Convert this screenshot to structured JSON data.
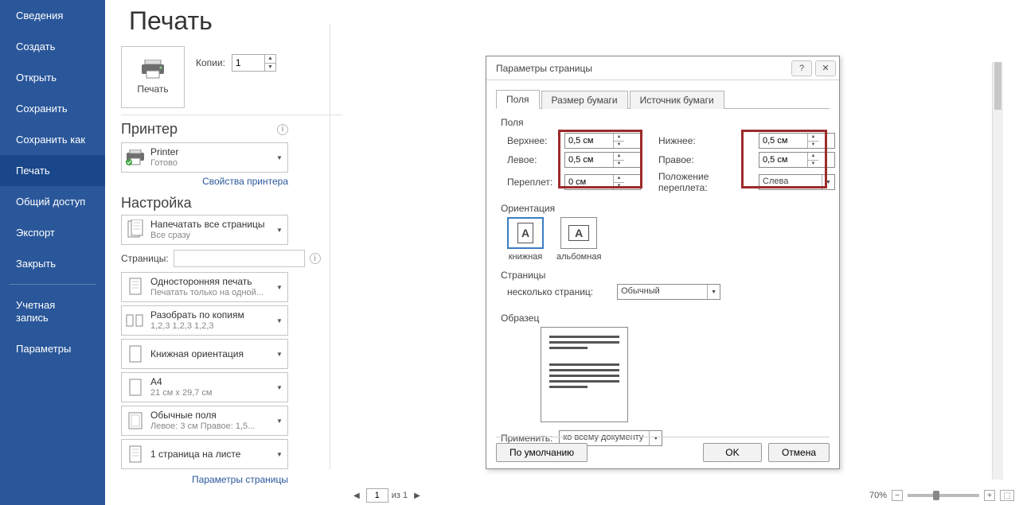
{
  "sidebar": {
    "items": [
      "Сведения",
      "Создать",
      "Открыть",
      "Сохранить",
      "Сохранить как",
      "Печать",
      "Общий доступ",
      "Экспорт",
      "Закрыть"
    ],
    "active_index": 5,
    "account_items": [
      "Учетная запись",
      "Параметры"
    ]
  },
  "page_title": "Печать",
  "print_button": "Печать",
  "copies_label": "Копии:",
  "copies_value": "1",
  "printer_section": "Принтер",
  "printer": {
    "name": "Printer",
    "status": "Готово"
  },
  "printer_props_link": "Свойства принтера",
  "settings_section": "Настройка",
  "settings": [
    {
      "t1": "Напечатать все страницы",
      "t2": "Все сразу",
      "icon": "pages-icon"
    },
    {
      "t1": "Односторонняя печать",
      "t2": "Печатать только на одной...",
      "icon": "side-icon"
    },
    {
      "t1": "Разобрать по копиям",
      "t2": "1,2,3   1,2,3   1,2,3",
      "icon": "collate-icon"
    },
    {
      "t1": "Книжная ориентация",
      "t2": "",
      "icon": "portrait-icon"
    },
    {
      "t1": "A4",
      "t2": "21 см x 29,7 см",
      "icon": "a4-icon"
    },
    {
      "t1": "Обычные поля",
      "t2": "Левое:  3 см   Правое:  1,5...",
      "icon": "margins-icon"
    },
    {
      "t1": "1 страница на листе",
      "t2": "",
      "icon": "onepage-icon"
    }
  ],
  "pages_label": "Страницы:",
  "page_setup_link": "Параметры страницы",
  "dialog": {
    "title": "Параметры страницы",
    "tabs": [
      "Поля",
      "Размер бумаги",
      "Источник бумаги"
    ],
    "active_tab": 0,
    "fields_legend": "Поля",
    "labels": {
      "top": "Верхнее:",
      "bottom": "Нижнее:",
      "left": "Левое:",
      "right": "Правое:",
      "gutter": "Переплет:",
      "gutter_pos": "Положение переплета:"
    },
    "values": {
      "top": "0,5 см",
      "bottom": "0,5 см",
      "left": "0,5 см",
      "right": "0,5 см",
      "gutter": "0 см",
      "gutter_pos": "Слева"
    },
    "orient_legend": "Ориентация",
    "orient": {
      "portrait": "книжная",
      "landscape": "альбомная"
    },
    "pages_legend": "Страницы",
    "multi_label": "несколько страниц:",
    "multi_value": "Обычный",
    "sample_legend": "Образец",
    "apply_label": "Применить:",
    "apply_value": "ко всему документу",
    "defaults_btn": "По умолчанию",
    "ok_btn": "OK",
    "cancel_btn": "Отмена"
  },
  "status": {
    "page_input": "1",
    "of": "из 1",
    "zoom": "70%"
  }
}
